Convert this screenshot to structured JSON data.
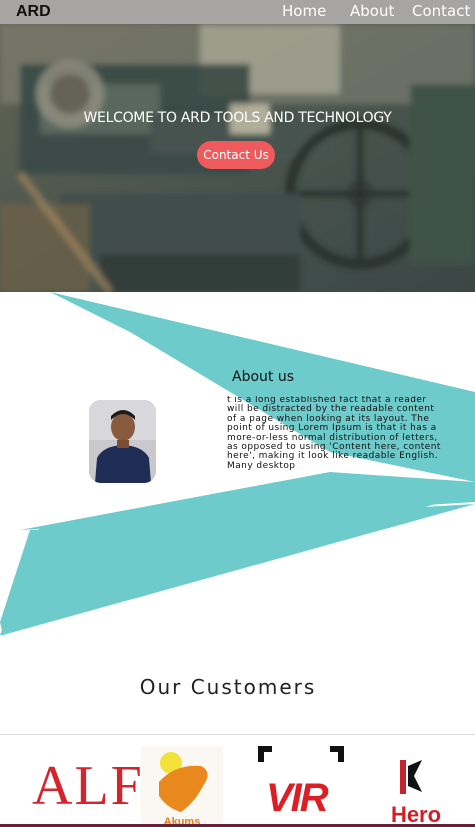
{
  "navbar": {
    "brand": "ARD",
    "links": [
      "Home",
      "About",
      "Contact"
    ]
  },
  "hero": {
    "title": "WELCOME TO ARD TOOLS AND TECHNOLOGY",
    "cta_label": "Contact Us"
  },
  "about": {
    "title": "About us",
    "body": "t is a long established fact that a reader will be distracted by the readable content of a page when looking at its layout. The point of using Lorem Ipsum is that it has a more-or-less normal distribution of letters, as opposed to using 'Content here, content here', making it look like readable English. Many desktop"
  },
  "customers": {
    "title": "Our Customers",
    "logos": [
      {
        "name": "ALF",
        "text": "ALF"
      },
      {
        "name": "Akums",
        "text": "Akums"
      },
      {
        "name": "VIR",
        "text": "VIR"
      },
      {
        "name": "Hero",
        "text": "Hero"
      }
    ]
  },
  "colors": {
    "navbar": "#a7a4a4",
    "teal_accent": "#6ecbcc",
    "cta": "#ef5a5c"
  }
}
